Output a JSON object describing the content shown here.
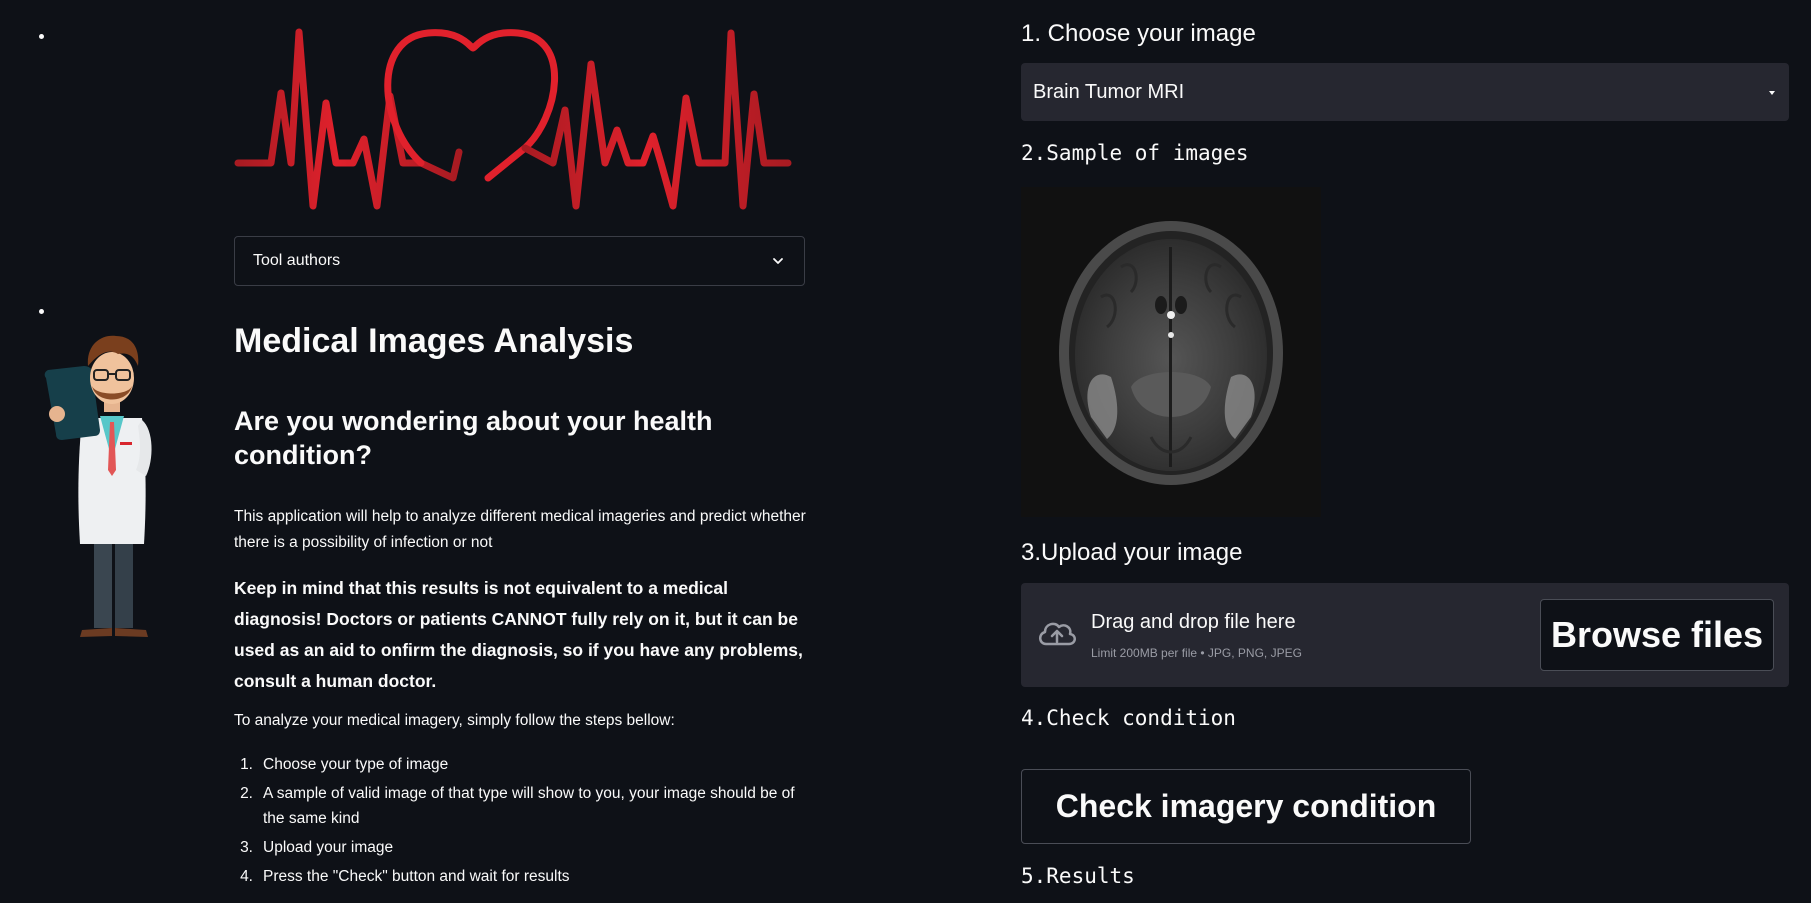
{
  "sidebar": {
    "expander_label": "Tool authors",
    "title": "Medical Images Analysis",
    "subtitle": "Are you wondering about your health condition?",
    "intro": "This application will help to analyze different medical imageries and predict whether there is a possibility of infection or not",
    "warning": "Keep in mind that this results is not equivalent to a medical diagnosis! Doctors or patients CANNOT fully rely on it, but it can be used as an aid to onfirm the diagnosis, so if you have any problems, consult a human doctor.",
    "steps_intro": "To analyze your medical imagery, simply follow the steps bellow:",
    "steps": [
      {
        "num": "1.",
        "text": "Choose your type of image"
      },
      {
        "num": "2.",
        "text": "A sample of valid image of that type will show to you, your image should be of the same kind"
      },
      {
        "num": "3.",
        "text": "Upload your image"
      },
      {
        "num": "4.",
        "text": "Press the \"Check\" button and wait for results"
      }
    ]
  },
  "main": {
    "section1": "1. Choose your image",
    "image_type": "Brain Tumor MRI",
    "section2": "2.Sample of images",
    "section3": "3.Upload your image",
    "upload": {
      "drag_text": "Drag and drop file here",
      "limit_text": "Limit 200MB per file • JPG, PNG, JPEG",
      "browse_label": "Browse files"
    },
    "section4": "4.Check condition",
    "check_label": "Check imagery condition",
    "section5": "5.Results"
  },
  "colors": {
    "background": "#0e1117",
    "panel": "#262730",
    "heart_red": "#d61f2a",
    "text": "#fafafa"
  }
}
